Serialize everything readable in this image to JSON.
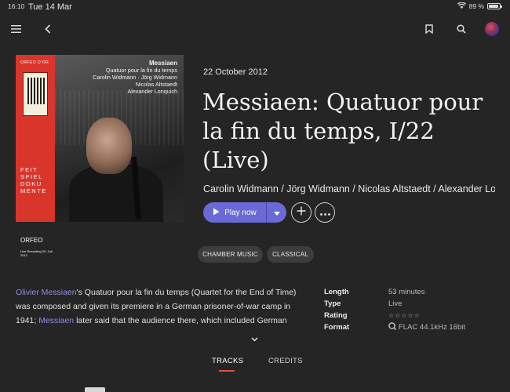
{
  "status_bar": {
    "time": "16:10",
    "date": "Tue 14 Mar",
    "battery_percent": "89 %",
    "battery_level": 0.89
  },
  "cover": {
    "label_top": "ORFEO D'OR",
    "composer": "Messiaen",
    "work": "Quatuor pour la fin du temps",
    "performers_line1": "Carolin Widmann · Jörg Widmann",
    "performers_line2": "Nicolas Altstaedt",
    "performers_line3": "Alexander Lonquich",
    "series_line1": "FEIT",
    "series_line2": "SPIEL",
    "series_line3": "DOKU",
    "series_line4": "MENTE",
    "label_bottom": "ORFEO",
    "live_note": "Live Recording 20. Juli 2012"
  },
  "album": {
    "release_date": "22 October 2012",
    "title": "Messiaen: Quatuor pour la fin du temps, I/22 (Live)",
    "artists": "Carolin Widmann / Jörg Widmann / Nicolas Altstaedt / Alexander Lonquich"
  },
  "actions": {
    "play_label": "Play now"
  },
  "tags": [
    "CHAMBER MUSIC",
    "CLASSICAL"
  ],
  "description": {
    "link1": "Olivier Messiaen",
    "text1": "'s Quatuor pour la fin du temps (Quartet for the End of Time) was composed and given its premiere in a German prisoner-of-war camp in 1941; ",
    "link2": "Messiaen",
    "text2": " later said that the audience there, which included German"
  },
  "metadata": [
    {
      "key": "Length",
      "value": "53 minutes"
    },
    {
      "key": "Type",
      "value": "Live"
    },
    {
      "key": "Rating",
      "value": "☆☆☆☆☆"
    },
    {
      "key": "Format",
      "value": "FLAC 44.1kHz 16bit"
    }
  ],
  "tabs": [
    {
      "label": "TRACKS",
      "active": true
    },
    {
      "label": "CREDITS",
      "active": false
    }
  ],
  "colors": {
    "accent": "#6b69d6",
    "link": "#8f8ee6",
    "tab_underline": "#e0503f",
    "background": "#252526",
    "cover_red": "#d9352b"
  }
}
